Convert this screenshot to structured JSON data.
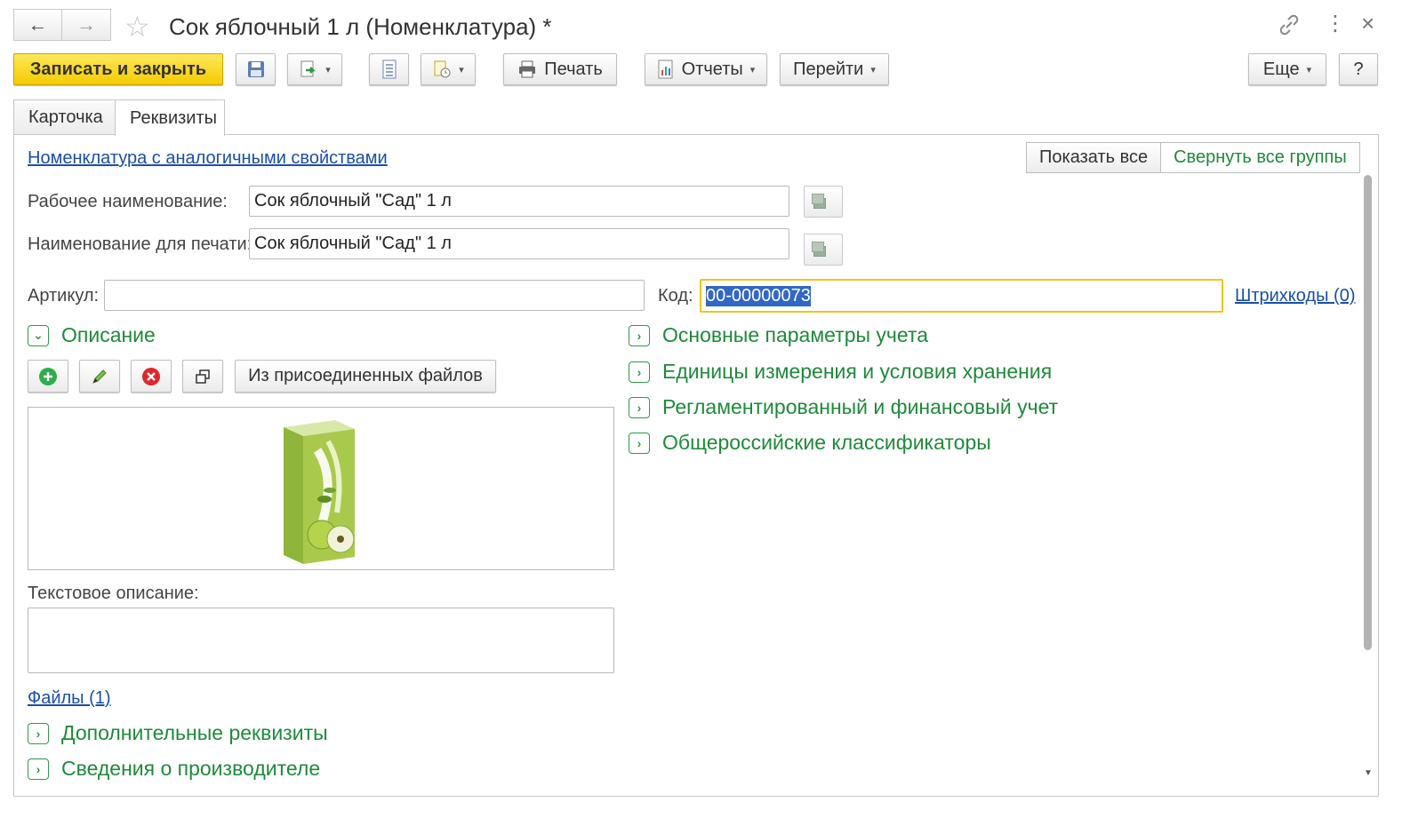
{
  "window": {
    "title": "Сок яблочный 1 л (Номенклатура) *",
    "back_icon": "←",
    "forward_icon": "→",
    "star_icon": "☆",
    "link_icon": "🔗",
    "more_icon": "⋮",
    "close_icon": "×"
  },
  "toolbar": {
    "save_close": "Записать и закрыть",
    "print": "Печать",
    "reports": "Отчеты",
    "goto": "Перейти",
    "more": "Еще",
    "help": "?",
    "caret": "▾"
  },
  "tabs": [
    {
      "label": "Карточка"
    },
    {
      "label": "Реквизиты"
    }
  ],
  "form": {
    "analog_link": "Номенклатура с аналогичными свойствами",
    "show_all": "Показать все",
    "collapse_all": "Свернуть все группы",
    "work_name_label": "Рабочее наименование:",
    "work_name_value": "Сок яблочный  \"Сад\"  1 л",
    "print_name_label": "Наименование для печати:",
    "print_name_value": "Сок яблочный \"Сад\" 1 л",
    "article_label": "Артикул:",
    "article_value": "",
    "code_label": "Код:",
    "code_value": "00-00000073",
    "barcodes_link": "Штрихкоды (0)",
    "description_group": "Описание",
    "from_files_button": "Из присоединенных файлов",
    "text_description_label": "Текстовое описание:",
    "files_link": "Файлы (1)"
  },
  "groups_right": [
    {
      "label": "Основные параметры учета"
    },
    {
      "label": "Единицы измерения и условия хранения"
    },
    {
      "label": "Регламентированный и финансовый учет"
    },
    {
      "label": "Общероссийские классификаторы"
    }
  ],
  "groups_bottom": [
    {
      "label": "Дополнительные реквизиты"
    },
    {
      "label": "Сведения о производителе"
    }
  ],
  "icons": {
    "expand": "›",
    "collapse": "⌄"
  },
  "colors": {
    "accent_yellow": "#f3cc00",
    "group_green": "#1e8a3a",
    "link_blue": "#1a4fa8",
    "selection": "#3167c6"
  }
}
